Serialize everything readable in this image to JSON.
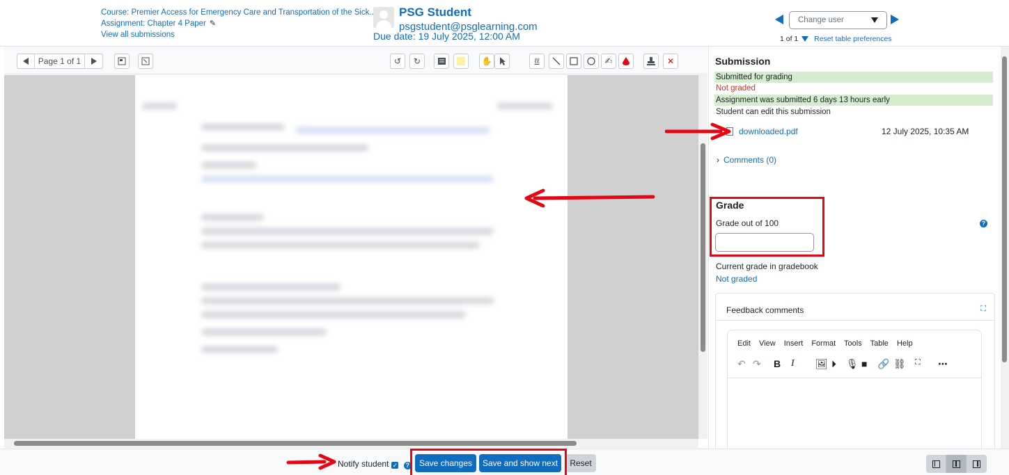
{
  "header": {
    "course": "Course: Premier Access for Emergency Care and Transportation of the Sick...",
    "assignment": "Assignment: Chapter 4 Paper",
    "view_all": "View all submissions",
    "user_name": "PSG Student",
    "user_email": "psgstudent@psglearning.com",
    "due_date": "Due date: 19 July 2025, 12:00 AM",
    "change_user_placeholder": "Change user",
    "pager_count": "1 of 1",
    "reset_table": "Reset table preferences"
  },
  "toolbar": {
    "page_label": "Page 1 of 1"
  },
  "submission": {
    "title": "Submission",
    "status": "Submitted for grading",
    "grading_status": "Not graded",
    "timing": "Assignment was submitted 6 days 13 hours early",
    "edit_status": "Student can edit this submission",
    "file_name": "downloaded.pdf",
    "file_date": "12 July 2025, 10:35 AM",
    "comments": "Comments (0)"
  },
  "grade": {
    "title": "Grade",
    "label": "Grade out of 100",
    "value": "",
    "current_label": "Current grade in gradebook",
    "current_value": "Not graded"
  },
  "feedback": {
    "title": "Feedback comments",
    "menu": [
      "Edit",
      "View",
      "Insert",
      "Format",
      "Tools",
      "Table",
      "Help"
    ]
  },
  "footer": {
    "notify": "Notify student",
    "notify_checked": true,
    "save": "Save changes",
    "save_next": "Save and show next",
    "reset": "Reset"
  },
  "colors": {
    "accent": "#0f6cbf",
    "success_bg": "#d4edcf",
    "danger_text": "#ca3120",
    "annotation": "#e30613"
  }
}
